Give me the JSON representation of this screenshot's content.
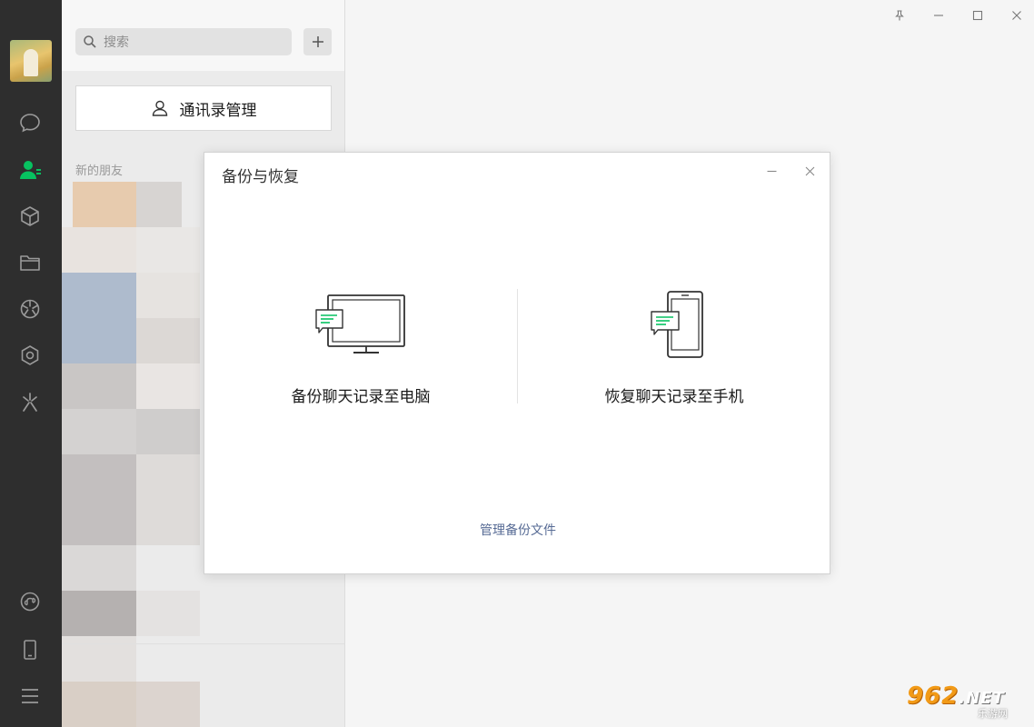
{
  "search": {
    "placeholder": "搜索"
  },
  "contacts": {
    "manage_button": "通讯录管理",
    "section_new_friends": "新的朋友"
  },
  "dialog": {
    "title": "备份与恢复",
    "option_backup": "备份聊天记录至电脑",
    "option_restore": "恢复聊天记录至手机",
    "manage_link": "管理备份文件"
  },
  "watermark": {
    "text": "962",
    "suffix": ".NET",
    "sub": "乐游网"
  },
  "colors": {
    "nav_bg": "#2e2e2e",
    "accent_green": "#07c160",
    "link_blue": "#576b95"
  },
  "nav": {
    "items": [
      "chat-icon",
      "contacts-icon",
      "favorites-icon",
      "files-icon",
      "moments-icon",
      "miniprogram-icon",
      "search-discover-icon"
    ],
    "bottom": [
      "miniprogram-panel-icon",
      "phone-icon",
      "menu-icon"
    ]
  }
}
